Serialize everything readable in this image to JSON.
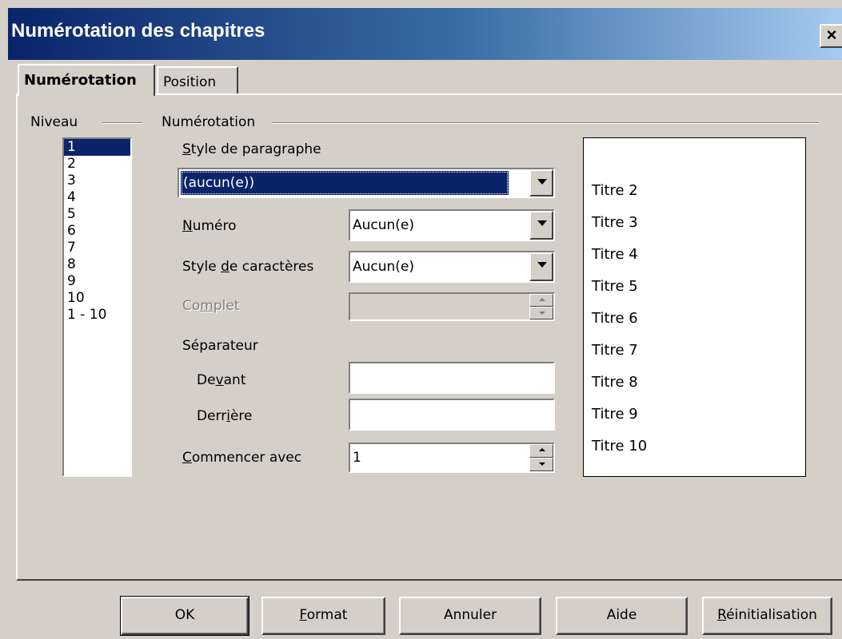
{
  "window": {
    "title": "Numérotation des chapitres",
    "close_glyph": "×"
  },
  "tabs": [
    {
      "label": "Numérotation",
      "active": true
    },
    {
      "label": "Position",
      "active": false
    }
  ],
  "level": {
    "legend": "Niveau",
    "items": [
      "1",
      "2",
      "3",
      "4",
      "5",
      "6",
      "7",
      "8",
      "9",
      "10",
      "1 - 10"
    ],
    "selected": "1"
  },
  "numbering": {
    "legend": "Numérotation",
    "paragraph_style": {
      "label_pre": "",
      "mnemonic": "S",
      "label_post": "tyle de paragraphe",
      "value": "(aucun(e))"
    },
    "number": {
      "label_pre": "",
      "mnemonic": "N",
      "label_post": "uméro",
      "value": "Aucun(e)"
    },
    "char_style": {
      "label_pre": "Style ",
      "mnemonic": "d",
      "label_post": "e caractères",
      "value": "Aucun(e)"
    },
    "complete": {
      "label_pre": "Co",
      "mnemonic": "m",
      "label_post": "plet",
      "value": ""
    },
    "separator": {
      "label": "Séparateur"
    },
    "before": {
      "label_pre": "De",
      "mnemonic": "v",
      "label_post": "ant",
      "value": ""
    },
    "after": {
      "label_pre": "Derr",
      "mnemonic": "i",
      "label_post": "ère",
      "value": ""
    },
    "start_at": {
      "label_pre": "",
      "mnemonic": "C",
      "label_post": "ommencer avec",
      "value": "1"
    }
  },
  "preview": {
    "lines": [
      "Titre 2",
      "Titre 3",
      "Titre 4",
      "Titre 5",
      "Titre 6",
      "Titre 7",
      "Titre 8",
      "Titre 9",
      "Titre 10"
    ]
  },
  "buttons": {
    "ok": "OK",
    "format": {
      "mnemonic": "F",
      "rest": "ormat"
    },
    "cancel": "Annuler",
    "help": "Aide",
    "reset": {
      "mnemonic": "R",
      "rest": "éinitialisation"
    }
  },
  "colors": {
    "titlebar_start": "#0a246a",
    "titlebar_end": "#a6caf0",
    "selection": "#0a246a",
    "face": "#d4d0c8"
  }
}
